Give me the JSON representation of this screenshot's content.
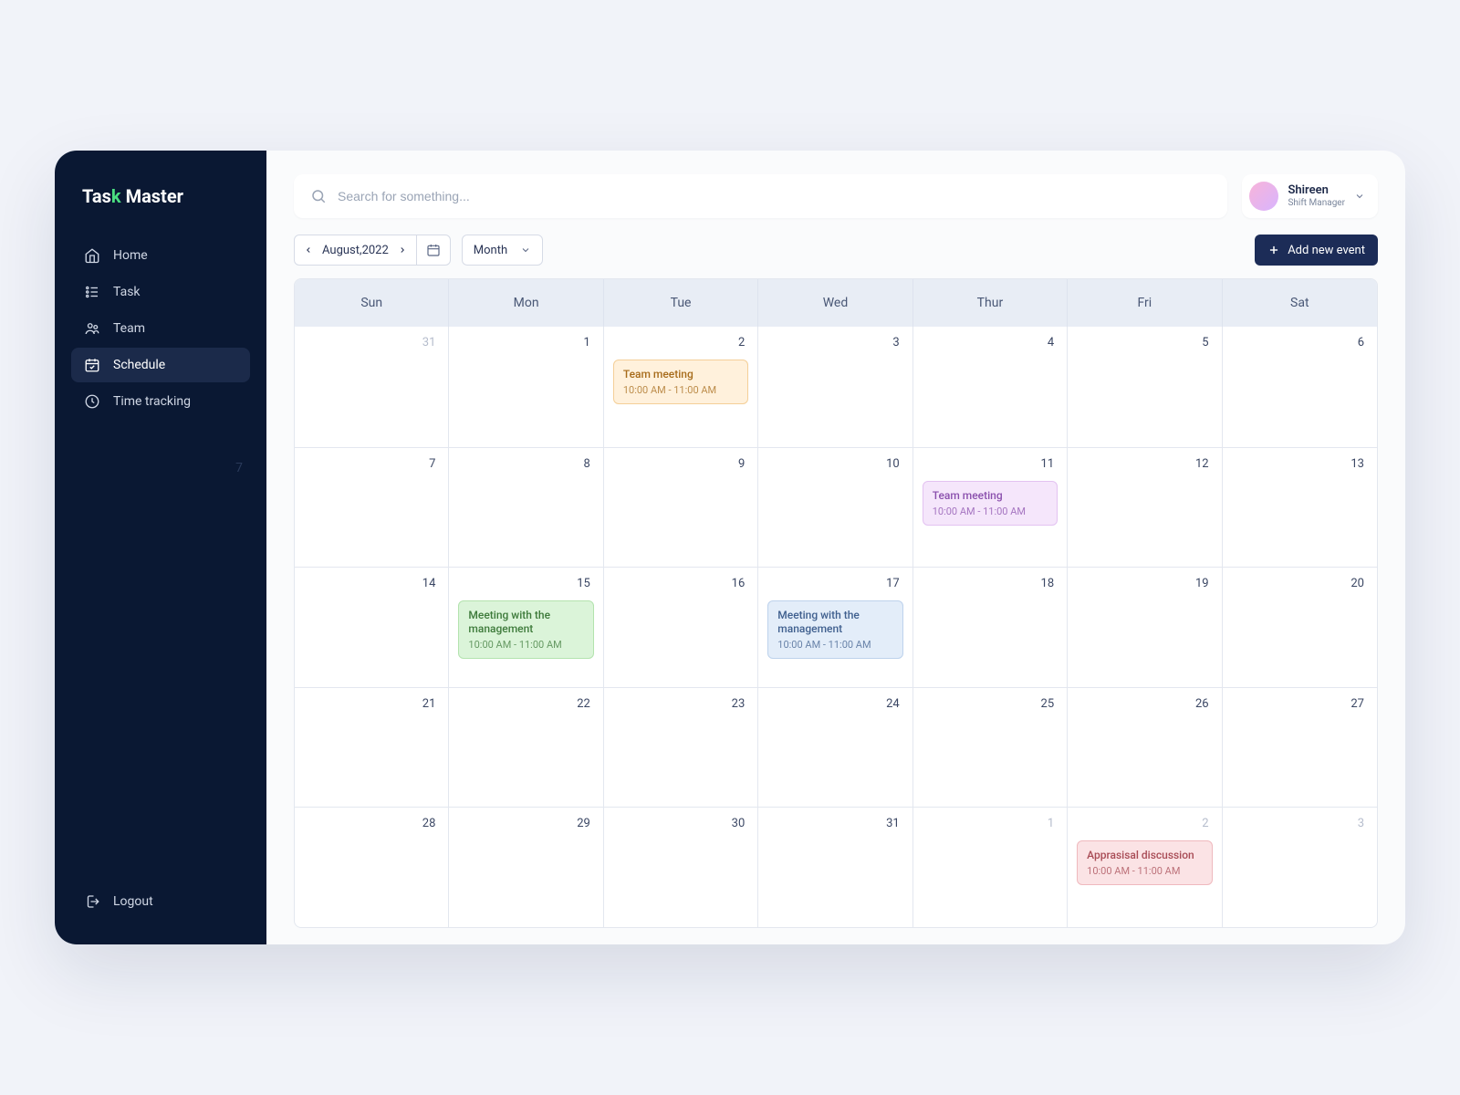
{
  "brand": {
    "part1": "Tas",
    "accent": "k",
    "part2": " Master"
  },
  "sidebar": {
    "items": [
      {
        "label": "Home",
        "icon": "home-icon"
      },
      {
        "label": "Task",
        "icon": "task-icon"
      },
      {
        "label": "Team",
        "icon": "team-icon"
      },
      {
        "label": "Schedule",
        "icon": "schedule-icon"
      },
      {
        "label": "Time tracking",
        "icon": "clock-icon"
      }
    ],
    "active_index": 3,
    "ghost_date": "7",
    "logout_label": "Logout"
  },
  "search": {
    "placeholder": "Search for something..."
  },
  "user": {
    "name": "Shireen",
    "role": "Shift Manager"
  },
  "toolbar": {
    "month_label": "August,2022",
    "view_label": "Month",
    "add_label": "Add new event"
  },
  "calendar": {
    "day_headers": [
      "Sun",
      "Mon",
      "Tue",
      "Wed",
      "Thur",
      "Fri",
      "Sat"
    ],
    "weeks": [
      [
        {
          "d": "31",
          "muted": true
        },
        {
          "d": "1"
        },
        {
          "d": "2",
          "event": {
            "title": "Team meeting",
            "time": "10:00 AM - 11:00 AM",
            "cls": "ev-orange"
          }
        },
        {
          "d": "3"
        },
        {
          "d": "4"
        },
        {
          "d": "5"
        },
        {
          "d": "6"
        }
      ],
      [
        {
          "d": "7"
        },
        {
          "d": "8"
        },
        {
          "d": "9"
        },
        {
          "d": "10"
        },
        {
          "d": "11",
          "event": {
            "title": "Team meeting",
            "time": "10:00 AM - 11:00 AM",
            "cls": "ev-purple"
          }
        },
        {
          "d": "12"
        },
        {
          "d": "13"
        }
      ],
      [
        {
          "d": "14"
        },
        {
          "d": "15",
          "event": {
            "title": "Meeting with the management",
            "time": "10:00 AM - 11:00 AM",
            "cls": "ev-green"
          }
        },
        {
          "d": "16"
        },
        {
          "d": "17",
          "event": {
            "title": "Meeting with the management",
            "time": "10:00 AM - 11:00 AM",
            "cls": "ev-blue"
          }
        },
        {
          "d": "18"
        },
        {
          "d": "19"
        },
        {
          "d": "20"
        }
      ],
      [
        {
          "d": "21"
        },
        {
          "d": "22"
        },
        {
          "d": "23"
        },
        {
          "d": "24"
        },
        {
          "d": "25"
        },
        {
          "d": "26"
        },
        {
          "d": "27"
        }
      ],
      [
        {
          "d": "28"
        },
        {
          "d": "29"
        },
        {
          "d": "30"
        },
        {
          "d": "31"
        },
        {
          "d": "1",
          "muted": true
        },
        {
          "d": "2",
          "muted": true,
          "event": {
            "title": "Apprasisal discussion",
            "time": "10:00 AM - 11:00 AM",
            "cls": "ev-red"
          }
        },
        {
          "d": "3",
          "muted": true
        }
      ]
    ]
  }
}
